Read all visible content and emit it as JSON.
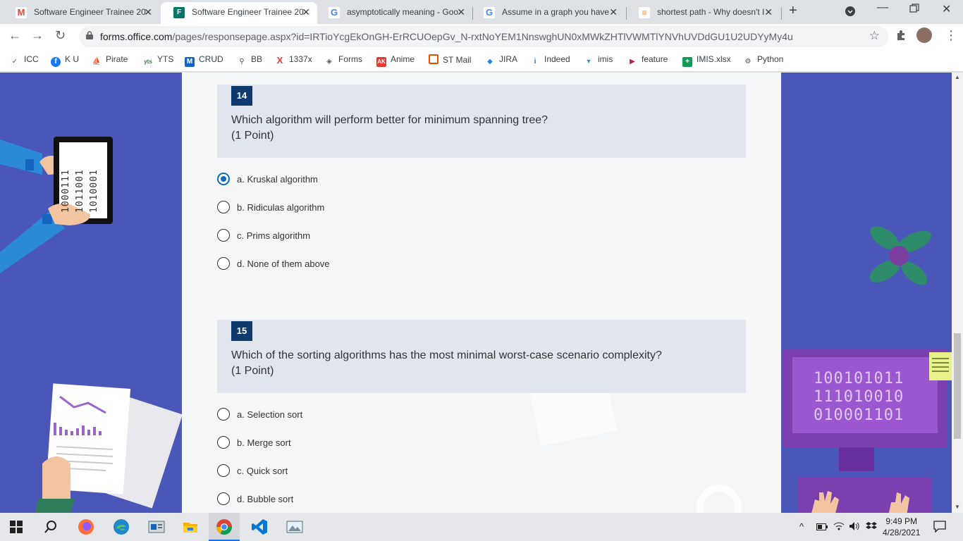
{
  "browser": {
    "tabs": [
      {
        "title": "Software Engineer Trainee 20",
        "icon": "gmail-icon"
      },
      {
        "title": "Software Engineer Trainee 20",
        "icon": "forms-icon"
      },
      {
        "title": "asymptotically meaning - Goo",
        "icon": "google-icon"
      },
      {
        "title": "Assume in a graph you have",
        "icon": "google-icon"
      },
      {
        "title": "shortest path - Why doesn't I",
        "icon": "stackoverflow-icon"
      }
    ],
    "url_host": "forms.office.com",
    "url_path": "/pages/responsepage.aspx?id=IRTioYcgEkOnGH-ErRCUOepGv_N-rxtNoYEM1NnswghUN0xMWkZHTlVWMTlYNVhUVDdGU1U2UDYyMy4u",
    "bookmarks": [
      "ICC",
      "K U",
      "Pirate",
      "YTS",
      "CRUD",
      "BB",
      "1337x",
      "Forms",
      "Anime",
      "ST Mail",
      "JIRA",
      "Indeed",
      "imis",
      "feature",
      "IMIS.xlsx",
      "Python"
    ]
  },
  "form": {
    "questions": [
      {
        "number": "14",
        "text": "Which algorithm will perform better for minimum spanning tree?",
        "points": "(1 Point)",
        "options": [
          "a. Kruskal algorithm",
          "b. Ridiculas algorithm",
          "c. Prims algorithm",
          "d. None of them above"
        ],
        "selected": 0
      },
      {
        "number": "15",
        "text": "Which of the sorting algorithms has the most minimal worst-case scenario complexity?",
        "points": "(1 Point)",
        "options": [
          "a. Selection sort",
          "b. Merge sort",
          "c. Quick sort",
          "d. Bubble sort"
        ],
        "selected": null
      }
    ]
  },
  "decor": {
    "binary_left": [
      "1000111",
      "1011001",
      "1010001"
    ],
    "binary_monitor": [
      "100101011",
      "111010010",
      "010001101"
    ]
  },
  "taskbar": {
    "time": "9:49 PM",
    "date": "4/28/2021"
  }
}
